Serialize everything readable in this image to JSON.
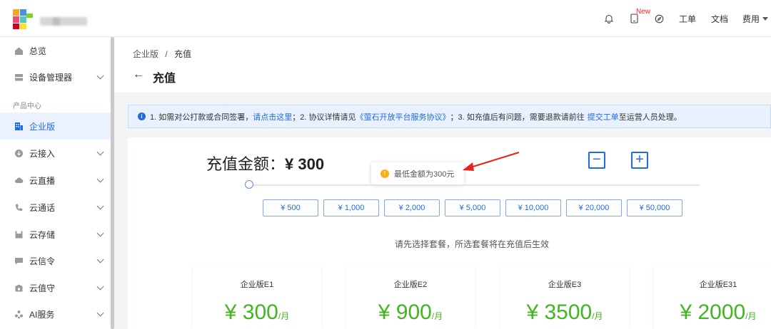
{
  "topbar": {
    "new_badge": "New",
    "ticket_label": "工单",
    "docs_label": "文档",
    "cost_label": "费用"
  },
  "sidebar": {
    "section_label": "产品中心",
    "items": [
      {
        "label": "总览",
        "icon": "home-icon"
      },
      {
        "label": "设备管理器",
        "icon": "server-icon"
      },
      {
        "label": "企业版",
        "icon": "building-icon"
      },
      {
        "label": "云接入",
        "icon": "cloud-access-icon"
      },
      {
        "label": "云直播",
        "icon": "cloud-live-icon"
      },
      {
        "label": "云通话",
        "icon": "phone-icon"
      },
      {
        "label": "云存储",
        "icon": "storage-icon"
      },
      {
        "label": "云信令",
        "icon": "message-icon"
      },
      {
        "label": "云值守",
        "icon": "guard-icon"
      },
      {
        "label": "AI服务",
        "icon": "ai-icon"
      }
    ]
  },
  "breadcrumb": {
    "parent": "企业版",
    "separator": "/",
    "current": "充值"
  },
  "page": {
    "back_arrow": "←",
    "title": "充值"
  },
  "notice": {
    "p1": "1. 如需对公打款或合同签署，",
    "link1": "请点击这里",
    "p2": "；2. 协议详情请见",
    "link2": "《萤石开放平台服务协议》",
    "p3": "；3. 如充值后有问题，需要退款请前往",
    "link3": "提交工单",
    "p4": "至运营人员处理。"
  },
  "recharge": {
    "amount_label": "充值金额：",
    "amount_value": "¥ 300",
    "minus": "−",
    "plus": "+",
    "tooltip": "最低金额为300元",
    "slider_value": 0,
    "amounts": [
      "¥ 500",
      "¥ 1,000",
      "¥ 2,000",
      "¥ 5,000",
      "¥ 10,000",
      "¥ 20,000",
      "¥ 50,000"
    ],
    "hint": "请先选择套餐，所选套餐将在充值后生效"
  },
  "packages": [
    {
      "name": "企业版E1",
      "price": "¥ 300",
      "unit": "/月"
    },
    {
      "name": "企业版E2",
      "price": "¥ 900",
      "unit": "/月"
    },
    {
      "name": "企业版E3",
      "price": "¥ 3500",
      "unit": "/月"
    },
    {
      "name": "企业版E31",
      "price": "¥ 2000",
      "unit": "/月"
    }
  ],
  "colors": {
    "accent": "#1e6be5",
    "price_green": "#43b51e",
    "arrow_red": "#e8231e",
    "warn": "#faad14"
  }
}
